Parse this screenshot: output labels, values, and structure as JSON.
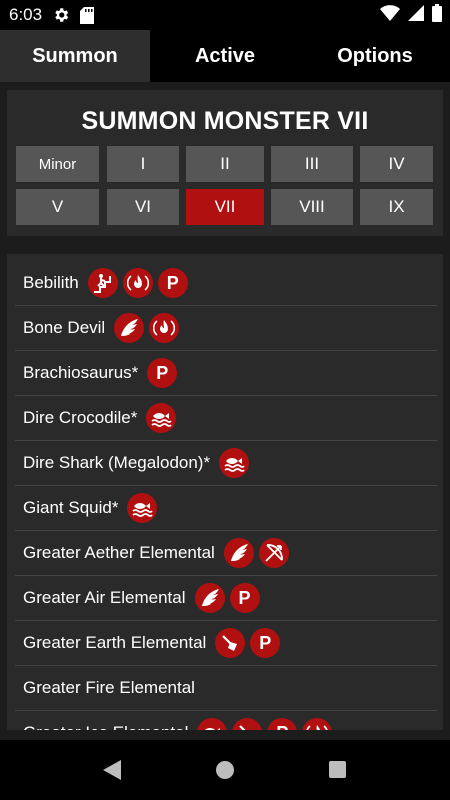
{
  "status_bar": {
    "time": "6:03"
  },
  "tabs": [
    {
      "label": "Summon",
      "active": true
    },
    {
      "label": "Active",
      "active": false
    },
    {
      "label": "Options",
      "active": false
    }
  ],
  "header": {
    "title": "SUMMON MONSTER VII"
  },
  "levels": [
    {
      "label": "Minor",
      "selected": false
    },
    {
      "label": "I",
      "selected": false
    },
    {
      "label": "II",
      "selected": false
    },
    {
      "label": "III",
      "selected": false
    },
    {
      "label": "IV",
      "selected": false
    },
    {
      "label": "V",
      "selected": false
    },
    {
      "label": "VI",
      "selected": false
    },
    {
      "label": "VII",
      "selected": true
    },
    {
      "label": "VIII",
      "selected": false
    },
    {
      "label": "IX",
      "selected": false
    }
  ],
  "monsters": [
    {
      "name": "Bebilith",
      "icons": [
        "climb-icon",
        "fire-resist-icon",
        "p-badge-icon"
      ]
    },
    {
      "name": "Bone Devil",
      "icons": [
        "wing-icon",
        "fire-resist-icon"
      ]
    },
    {
      "name": "Brachiosaurus*",
      "icons": [
        "p-badge-icon"
      ]
    },
    {
      "name": "Dire Crocodile*",
      "icons": [
        "swim-icon"
      ]
    },
    {
      "name": "Dire Shark (Megalodon)*",
      "icons": [
        "swim-icon"
      ]
    },
    {
      "name": "Giant Squid*",
      "icons": [
        "swim-icon"
      ]
    },
    {
      "name": "Greater Aether Elemental",
      "icons": [
        "wing-icon",
        "bow-icon"
      ]
    },
    {
      "name": "Greater Air Elemental",
      "icons": [
        "wing-icon",
        "p-badge-icon"
      ]
    },
    {
      "name": "Greater Earth Elemental",
      "icons": [
        "burrow-icon",
        "p-badge-icon"
      ]
    },
    {
      "name": "Greater Fire Elemental",
      "icons": []
    },
    {
      "name": "Greater Ice Elemental",
      "icons": [
        "swim-icon",
        "burrow-icon",
        "p-badge-icon",
        "fire-resist-icon"
      ]
    }
  ],
  "colors": {
    "accent": "#b01010",
    "panel": "#2a2a2a",
    "button": "#565656",
    "background": "#1c1c1c"
  }
}
